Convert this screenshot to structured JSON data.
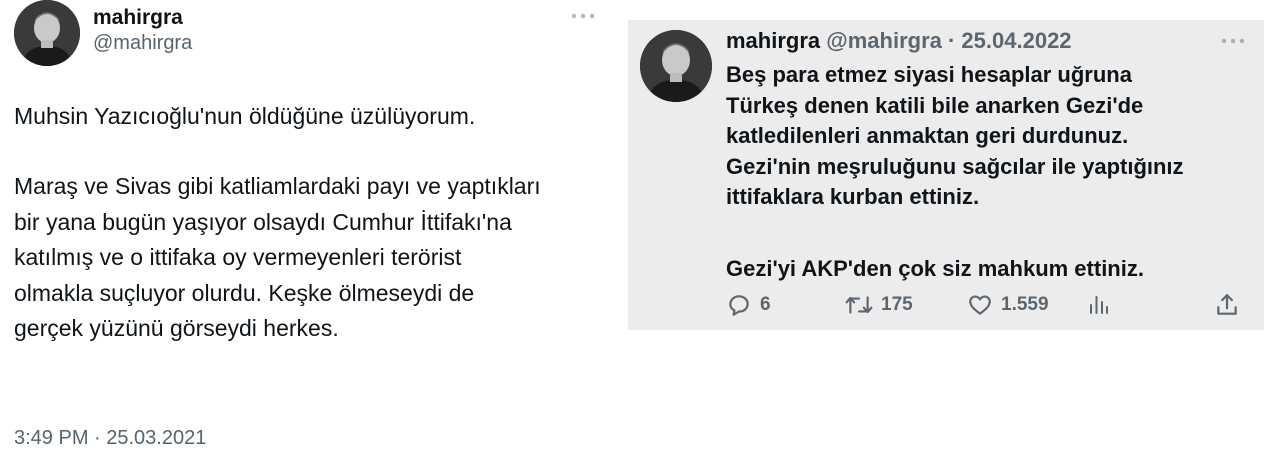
{
  "left_tweet": {
    "display_name": "mahirgra",
    "handle": "@mahirgra",
    "more_icon": "more-dots-icon",
    "paragraph1": "Muhsin Yazıcıoğlu'nun öldüğüne üzülüyorum.",
    "paragraph2_lines": [
      "Maraş ve Sivas gibi katliamlardaki payı ve yaptıkları",
      "bir yana bugün yaşıyor olsaydı Cumhur İttifakı'na",
      "katılmış ve o ittifaka oy vermeyenleri terörist",
      "olmakla suçluyor olurdu. Keşke ölmeseydi de",
      "gerçek yüzünü görseydi herkes."
    ],
    "timestamp": "3:49 PM · 25.03.2021"
  },
  "right_tweet": {
    "display_name": "mahirgra",
    "handle_date": "@mahirgra · 25.04.2022",
    "more_icon": "more-dots-icon",
    "paragraph1_lines": [
      "Beş para etmez siyasi hesaplar uğruna",
      "Türkeş denen katili bile anarken Gezi'de",
      "katledilenleri anmaktan geri durdunuz.",
      "Gezi'nin meşruluğunu sağcılar ile yaptığınız",
      "ittifaklara kurban ettiniz."
    ],
    "paragraph2": "Gezi'yi AKP'den çok siz mahkum ettiniz.",
    "actions": {
      "replies": "6",
      "retweets": "175",
      "likes": "1.559"
    },
    "icons": {
      "reply": "reply-bubble-icon",
      "retweet": "retweet-icon",
      "like": "heart-icon",
      "views": "views-bar-chart-icon",
      "share": "share-icon"
    },
    "colors": {
      "card_background": "#ececec",
      "secondary_text": "#5b6670"
    }
  }
}
